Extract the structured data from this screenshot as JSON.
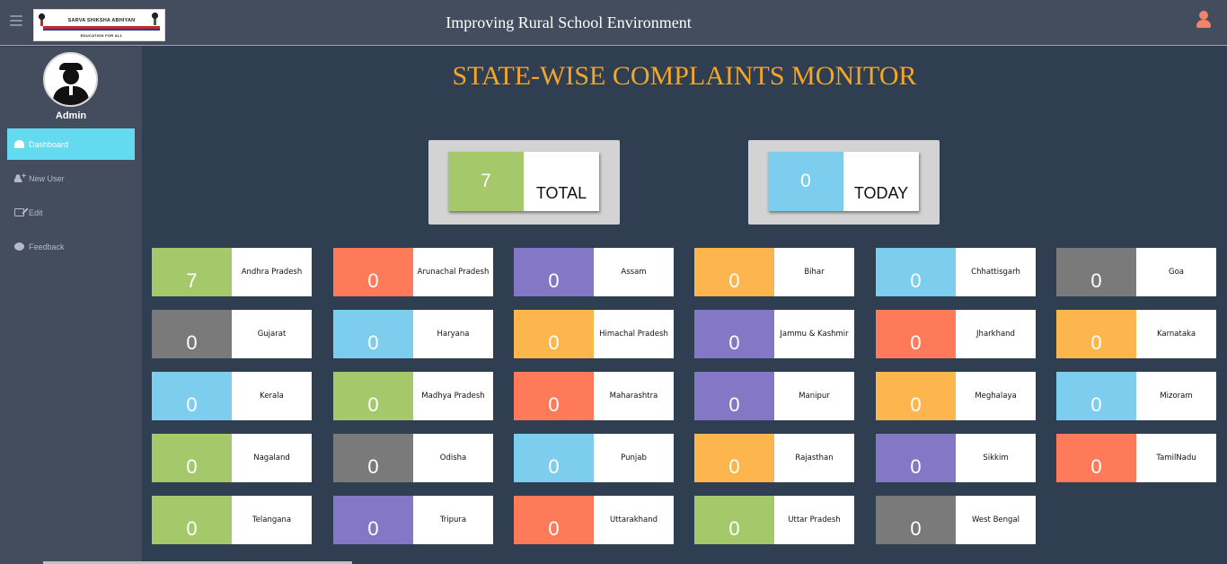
{
  "header": {
    "app_title": "Improving Rural School Environment",
    "logo_title": "SARVA SHIKSHA ABHIYAN",
    "logo_subtitle": "EDUCATION FOR ALL"
  },
  "sidebar": {
    "user_name": "Admin",
    "items": [
      {
        "label": "Dashboard",
        "icon": "dashboard-icon",
        "active": true
      },
      {
        "label": "New User",
        "icon": "user-plus-icon",
        "active": false
      },
      {
        "label": "Edit",
        "icon": "edit-icon",
        "active": false
      },
      {
        "label": "Feedback",
        "icon": "chat-icon",
        "active": false
      }
    ]
  },
  "main": {
    "title": "STATE-WISE COMPLAINTS MONITOR",
    "summary": {
      "total": {
        "value": "7",
        "label": "TOTAL",
        "color": "#a5c96a"
      },
      "today": {
        "value": "0",
        "label": "TODAY",
        "color": "#7dcdef"
      }
    },
    "states": [
      {
        "name": "Andhra Pradesh",
        "count": "7",
        "color": "green"
      },
      {
        "name": "Arunachal Pradesh",
        "count": "0",
        "color": "red"
      },
      {
        "name": "Assam",
        "count": "0",
        "color": "purple"
      },
      {
        "name": "Bihar",
        "count": "0",
        "color": "orange"
      },
      {
        "name": "Chhattisgarh",
        "count": "0",
        "color": "blue"
      },
      {
        "name": "Goa",
        "count": "0",
        "color": "gray"
      },
      {
        "name": "Gujarat",
        "count": "0",
        "color": "gray"
      },
      {
        "name": "Haryana",
        "count": "0",
        "color": "blue"
      },
      {
        "name": "Himachal Pradesh",
        "count": "0",
        "color": "orange"
      },
      {
        "name": "Jammu & Kashmir",
        "count": "0",
        "color": "purple"
      },
      {
        "name": "Jharkhand",
        "count": "0",
        "color": "red"
      },
      {
        "name": "Karnataka",
        "count": "0",
        "color": "orange"
      },
      {
        "name": "Kerala",
        "count": "0",
        "color": "blue"
      },
      {
        "name": "Madhya Pradesh",
        "count": "0",
        "color": "green"
      },
      {
        "name": "Maharashtra",
        "count": "0",
        "color": "red"
      },
      {
        "name": "Manipur",
        "count": "0",
        "color": "purple"
      },
      {
        "name": "Meghalaya",
        "count": "0",
        "color": "orange"
      },
      {
        "name": "Mizoram",
        "count": "0",
        "color": "blue"
      },
      {
        "name": "Nagaland",
        "count": "0",
        "color": "green"
      },
      {
        "name": "Odisha",
        "count": "0",
        "color": "gray"
      },
      {
        "name": "Punjab",
        "count": "0",
        "color": "blue"
      },
      {
        "name": "Rajasthan",
        "count": "0",
        "color": "orange"
      },
      {
        "name": "Sikkim",
        "count": "0",
        "color": "purple"
      },
      {
        "name": "TamilNadu",
        "count": "0",
        "color": "red"
      },
      {
        "name": "Telangana",
        "count": "0",
        "color": "green"
      },
      {
        "name": "Tripura",
        "count": "0",
        "color": "purple"
      },
      {
        "name": "Uttarakhand",
        "count": "0",
        "color": "red"
      },
      {
        "name": "Uttar Pradesh",
        "count": "0",
        "color": "green"
      },
      {
        "name": "West Bengal",
        "count": "0",
        "color": "gray"
      }
    ]
  },
  "colors": {
    "accent_title": "#f5a623",
    "active_nav": "#63daf0",
    "background": "#2f3e51",
    "panel": "#434d5d"
  }
}
